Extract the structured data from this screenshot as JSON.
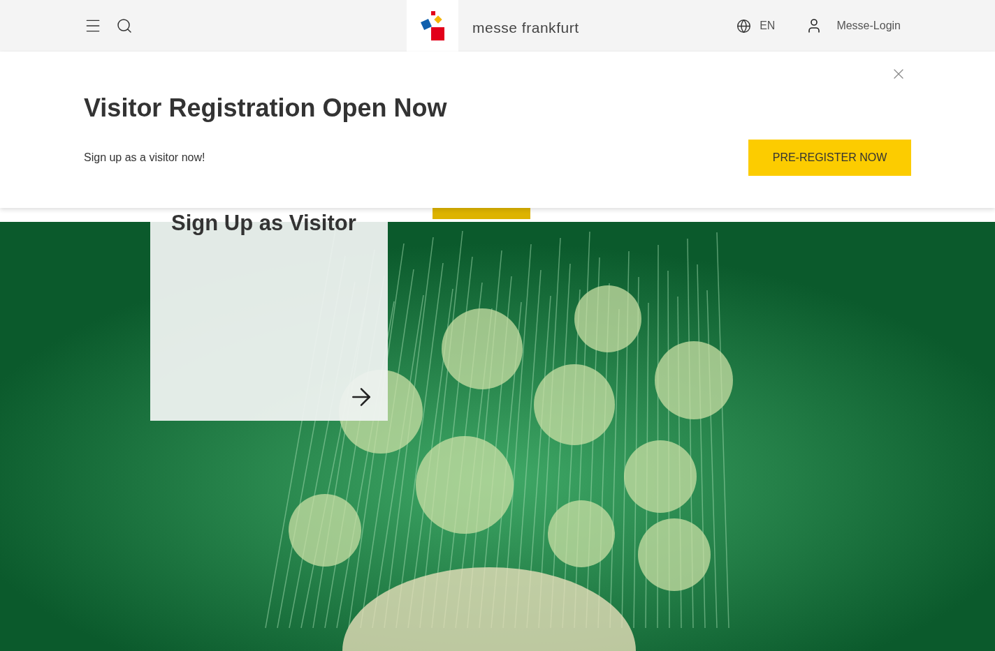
{
  "header": {
    "brand": "messe frankfurt",
    "language": "EN",
    "login": "Messe-Login"
  },
  "banner": {
    "title": "Visitor Registration Open Now",
    "text": "Sign up as a visitor now!",
    "button": "PRE-REGISTER NOW"
  },
  "hero": {
    "card_title": "Sign Up as Visitor"
  }
}
